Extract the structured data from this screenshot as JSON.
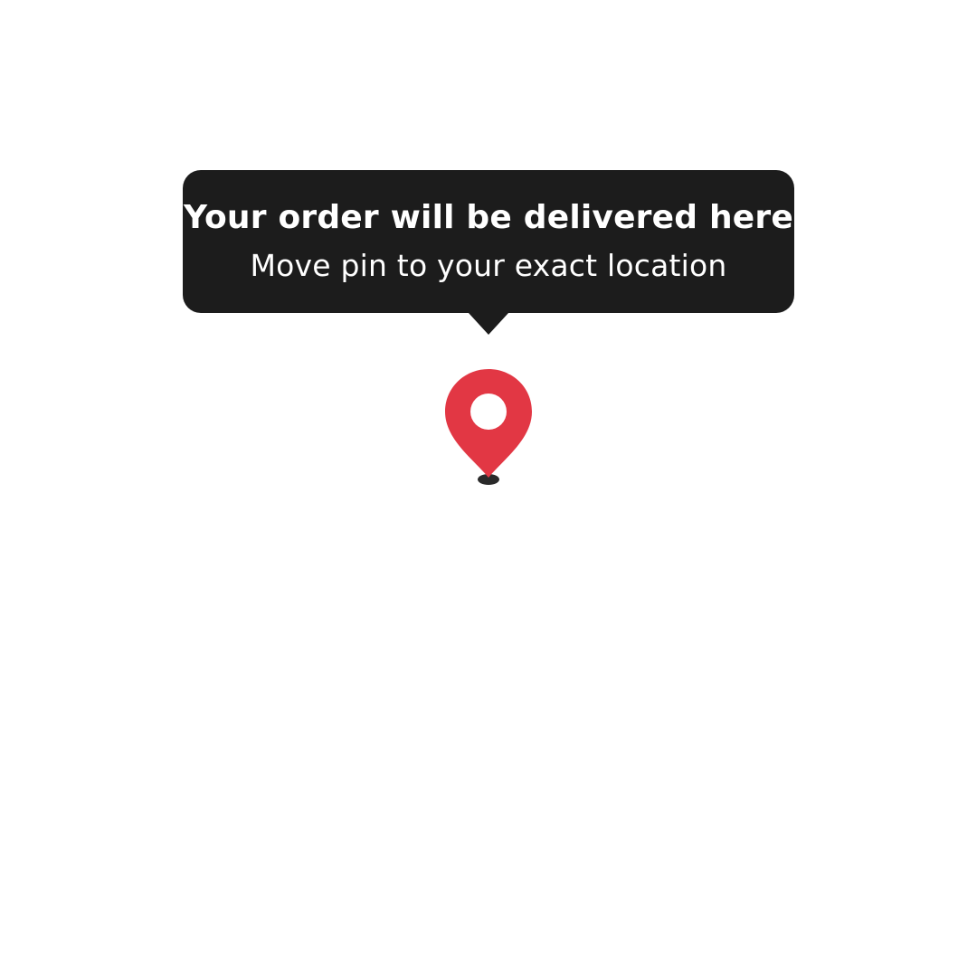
{
  "tooltip": {
    "title": "Your order will be delivered here",
    "subtitle": "Move pin to your exact location"
  },
  "pin": {
    "icon": "location-pin-icon"
  },
  "colors": {
    "background": "#ffffff",
    "tooltip_background": "#1c1c1c",
    "tooltip_text": "#ffffff",
    "pin": "#e23744",
    "pin_shadow": "#2a2a2a"
  }
}
